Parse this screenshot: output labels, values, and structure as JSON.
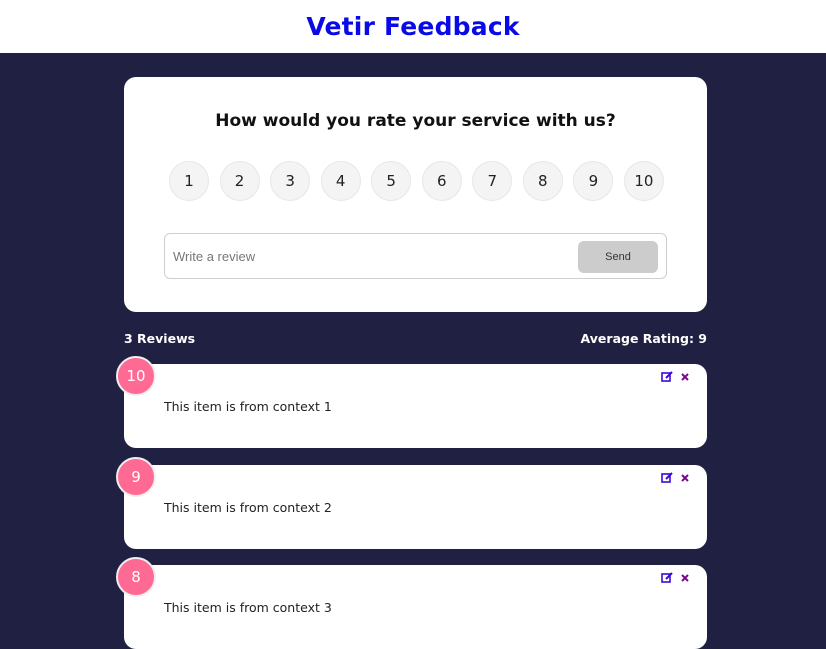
{
  "header": {
    "title": "Vetir Feedback"
  },
  "rating_card": {
    "question": "How would you rate your service with us?",
    "options": [
      "1",
      "2",
      "3",
      "4",
      "5",
      "6",
      "7",
      "8",
      "9",
      "10"
    ],
    "review_placeholder": "Write a review",
    "send_label": "Send"
  },
  "stats": {
    "count_text": "3 Reviews",
    "average_text": "Average Rating: 9"
  },
  "reviews": [
    {
      "rating": "10",
      "text": "This item is from context 1"
    },
    {
      "rating": "9",
      "text": "This item is from context 2"
    },
    {
      "rating": "8",
      "text": "This item is from context 3"
    }
  ],
  "colors": {
    "background": "#202142",
    "title": "#0a0ae6",
    "badge": "#ff6a95",
    "edit_icon": "#3b0ad6",
    "delete_icon": "#7a0a8a"
  },
  "icons": {
    "edit": "edit-icon",
    "delete": "close-icon"
  }
}
